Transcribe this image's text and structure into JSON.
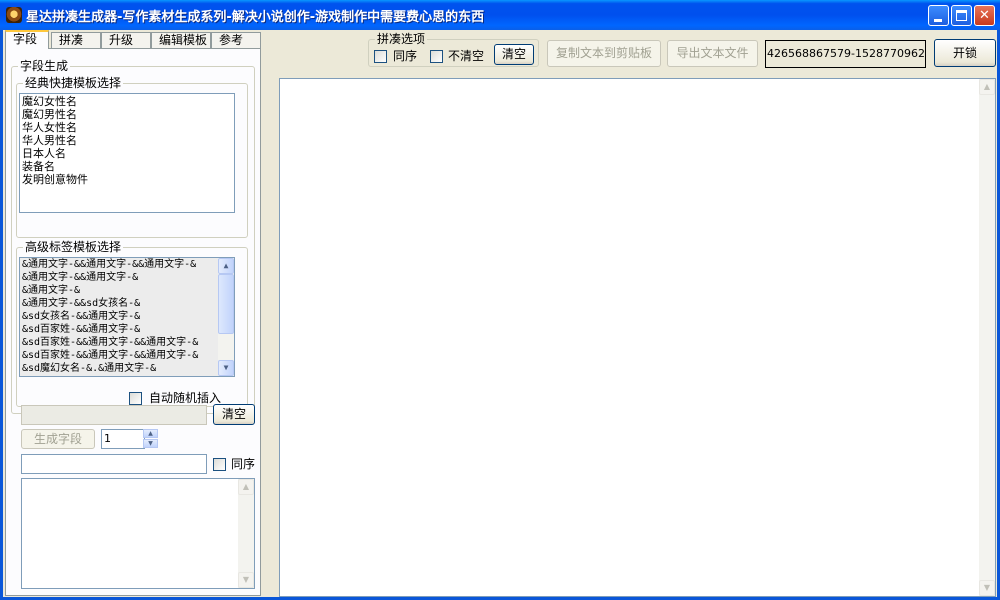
{
  "window": {
    "title": "星达拼凑生成器-写作素材生成系列-解决小说创作-游戏制作中需要费心思的东西"
  },
  "tabs": [
    "字段",
    "拼凑",
    "升级",
    "编辑模板",
    "参考"
  ],
  "panel": {
    "field_group_label": "字段生成",
    "classic_label": "经典快捷模板选择",
    "classic_items": [
      "魔幻女性名",
      "魔幻男性名",
      "华人女性名",
      "华人男性名",
      "日本人名",
      "装备名",
      "发明创意物件"
    ],
    "advanced_label": "高级标签模板选择",
    "advanced_items": [
      "&通用文字-&&通用文字-&&通用文字-&",
      "&通用文字-&&通用文字-&",
      "&通用文字-&",
      "&通用文字-&&sd女孩名-&",
      "&sd女孩名-&&通用文字-&",
      "&sd百家姓-&&通用文字-&",
      "&sd百家姓-&&通用文字-&&通用文字-&",
      "&sd百家姓-&&通用文字-&&通用文字-&",
      "&sd魔幻女名-&.&通用文字-&"
    ],
    "auto_insert_label": "自动随机插入",
    "clear_label": "清空",
    "generate_label": "生成字段",
    "count_value": "1",
    "sequence_label": "同序"
  },
  "toolbar": {
    "group_label": "拼凑选项",
    "same_order_label": "同序",
    "no_clear_label": "不清空",
    "clear_label": "清空",
    "copy_label": "复制文本到剪贴板",
    "export_label": "导出文本文件",
    "code": "426568867579-1528770962",
    "unlock_label": "开锁"
  }
}
